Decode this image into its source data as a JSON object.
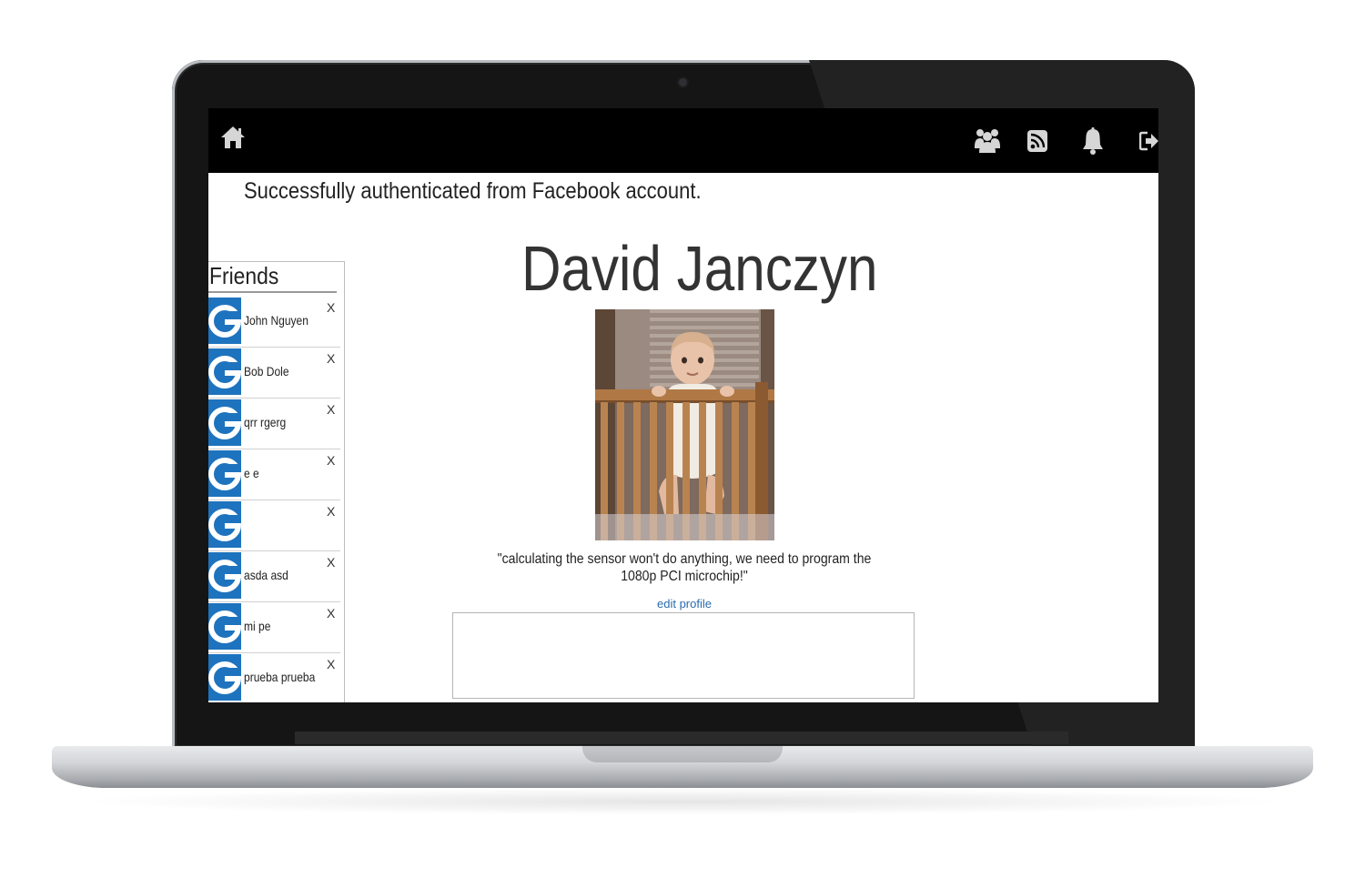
{
  "colors": {
    "navbar_bg": "#000000",
    "nav_icon": "#d6d6d6",
    "avatar_bg": "#1e73be",
    "link": "#2a6bb0"
  },
  "navbar": {
    "icons": [
      "home-icon",
      "friends-icon",
      "rss-feed-icon",
      "notifications-bell-icon",
      "logout-icon"
    ]
  },
  "flash": {
    "message": "Successfully authenticated from Facebook account."
  },
  "friends": {
    "title": "Friends",
    "remove_label": "X",
    "items": [
      {
        "name": "John Nguyen"
      },
      {
        "name": "Bob Dole"
      },
      {
        "name": "qrr rgerg"
      },
      {
        "name": "e e"
      },
      {
        "name": ""
      },
      {
        "name": "asda asd"
      },
      {
        "name": "mi pe"
      },
      {
        "name": "prueba prueba"
      }
    ]
  },
  "profile": {
    "name": "David Janczyn",
    "quote": "\"calculating the sensor won't do anything, we need to program the 1080p PCI microchip!\"",
    "edit_label": "edit profile",
    "post_value": ""
  }
}
